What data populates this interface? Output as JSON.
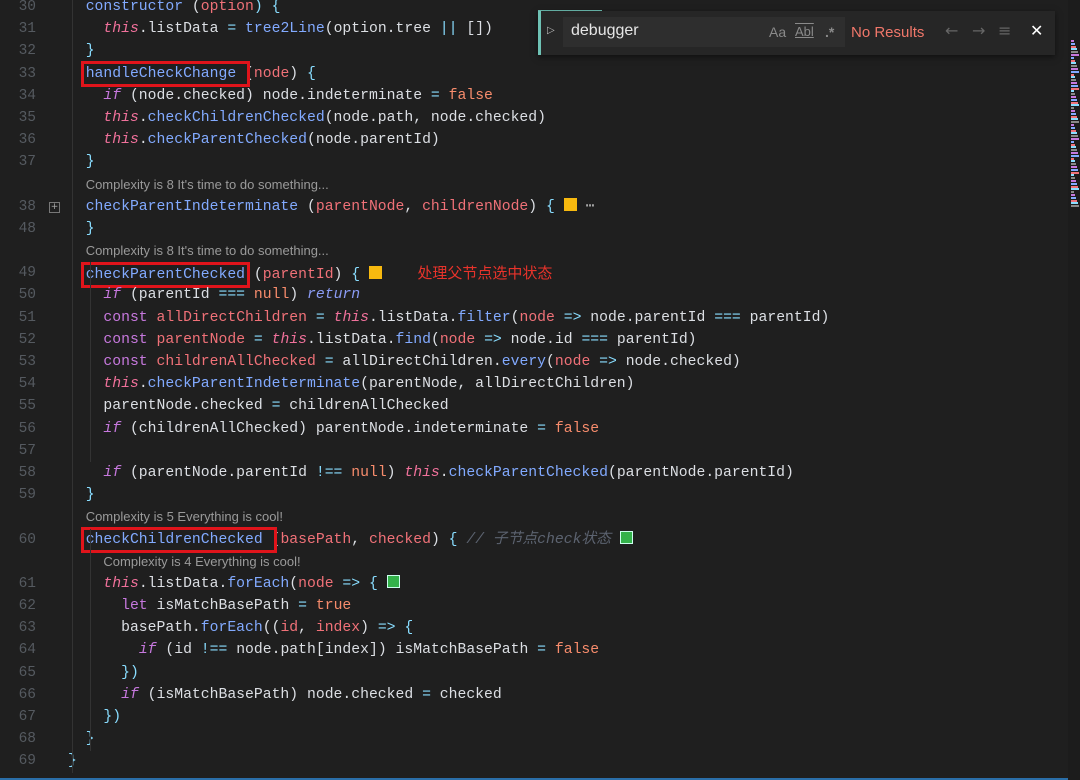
{
  "find": {
    "value": "debugger",
    "match_case": "Aa",
    "whole_word": "Abl",
    "regex": ".*",
    "result": "No Results",
    "prev": "←",
    "next": "→",
    "selection": "≡",
    "close": "✕",
    "toggle": "▷"
  },
  "colors": {
    "accent": "#6fc2b5",
    "highlight_box": "#e0141b",
    "background": "#1f1f1f"
  },
  "rows": [
    {
      "n": "30",
      "t": [
        [
          "  ",
          ""
        ],
        [
          "constructor",
          "fn"
        ],
        [
          " (",
          ""
        ],
        [
          "option",
          "par"
        ],
        [
          ") {",
          "pun"
        ]
      ]
    },
    {
      "n": "31",
      "t": [
        [
          "    ",
          ""
        ],
        [
          "this",
          "this"
        ],
        [
          ".listData ",
          ""
        ],
        [
          "=",
          "op"
        ],
        [
          " ",
          ""
        ],
        [
          "tree2Line",
          "fn"
        ],
        [
          "(option.tree ",
          ""
        ],
        [
          "||",
          "op"
        ],
        [
          " [])",
          ""
        ]
      ]
    },
    {
      "n": "32",
      "t": [
        [
          "  ",
          ""
        ],
        [
          "}",
          "pun"
        ]
      ]
    },
    {
      "n": "33",
      "t": [
        [
          "  ",
          ""
        ],
        [
          "handleCheckChange ",
          "fn boxed"
        ],
        [
          "(",
          ""
        ],
        [
          "node",
          "par"
        ],
        [
          ") ",
          ""
        ],
        [
          "{",
          "pun"
        ]
      ]
    },
    {
      "n": "34",
      "t": [
        [
          "    ",
          ""
        ],
        [
          "if",
          "kwi"
        ],
        [
          " (node.checked) node.indeterminate ",
          ""
        ],
        [
          "=",
          "op"
        ],
        [
          " ",
          ""
        ],
        [
          "false",
          "bool"
        ]
      ]
    },
    {
      "n": "35",
      "t": [
        [
          "    ",
          ""
        ],
        [
          "this",
          "this"
        ],
        [
          ".",
          ""
        ],
        [
          "checkChildrenChecked",
          "fn"
        ],
        [
          "(node.path, node.checked)",
          ""
        ]
      ]
    },
    {
      "n": "36",
      "t": [
        [
          "    ",
          ""
        ],
        [
          "this",
          "this"
        ],
        [
          ".",
          ""
        ],
        [
          "checkParentChecked",
          "fn"
        ],
        [
          "(node.parentId)",
          ""
        ]
      ]
    },
    {
      "n": "37",
      "t": [
        [
          "  ",
          ""
        ],
        [
          "}",
          "pun"
        ]
      ]
    },
    {
      "lens": "Complexity is 8 It's time to do something...",
      "ind": 2
    },
    {
      "n": "38",
      "fold": "+",
      "t": [
        [
          "  ",
          ""
        ],
        [
          "checkParentIndeterminate",
          "fn"
        ],
        [
          " (",
          ""
        ],
        [
          "parentNode",
          "par"
        ],
        [
          ", ",
          ""
        ],
        [
          "childrenNode",
          "par"
        ],
        [
          ") ",
          ""
        ],
        [
          "{",
          "pun"
        ],
        [
          " ",
          ""
        ],
        [
          "",
          "sq-y"
        ],
        [
          " ",
          ""
        ],
        [
          "⋯",
          "ell"
        ]
      ]
    },
    {
      "n": "48",
      "t": [
        [
          "  ",
          ""
        ],
        [
          "}",
          "pun"
        ]
      ]
    },
    {
      "lens": "Complexity is 8 It's time to do something...",
      "ind": 2
    },
    {
      "n": "49",
      "t": [
        [
          "  ",
          ""
        ],
        [
          "checkParentChecked",
          "fn boxed"
        ],
        [
          " (",
          ""
        ],
        [
          "parentId",
          "par"
        ],
        [
          ") ",
          ""
        ],
        [
          "{",
          "pun"
        ],
        [
          " ",
          ""
        ],
        [
          "",
          "sq-y"
        ],
        [
          "    ",
          ""
        ],
        [
          "处理父节点选中状态",
          "note"
        ]
      ]
    },
    {
      "n": "50",
      "t": [
        [
          "    ",
          ""
        ],
        [
          "if",
          "kwi"
        ],
        [
          " (parentId ",
          ""
        ],
        [
          "===",
          "op"
        ],
        [
          " ",
          ""
        ],
        [
          "null",
          "bool"
        ],
        [
          ") ",
          ""
        ],
        [
          "return",
          "ret"
        ]
      ]
    },
    {
      "n": "51",
      "t": [
        [
          "    ",
          ""
        ],
        [
          "const",
          "kw"
        ],
        [
          " ",
          ""
        ],
        [
          "allDirectChildren",
          "par"
        ],
        [
          " ",
          ""
        ],
        [
          "=",
          "op"
        ],
        [
          " ",
          ""
        ],
        [
          "this",
          "this"
        ],
        [
          ".listData.",
          ""
        ],
        [
          "filter",
          "fn"
        ],
        [
          "(",
          ""
        ],
        [
          "node",
          "par"
        ],
        [
          " ",
          ""
        ],
        [
          "=>",
          "op"
        ],
        [
          " node.parentId ",
          ""
        ],
        [
          "===",
          "op"
        ],
        [
          " parentId)",
          ""
        ]
      ]
    },
    {
      "n": "52",
      "t": [
        [
          "    ",
          ""
        ],
        [
          "const",
          "kw"
        ],
        [
          " ",
          ""
        ],
        [
          "parentNode",
          "par"
        ],
        [
          " ",
          ""
        ],
        [
          "=",
          "op"
        ],
        [
          " ",
          ""
        ],
        [
          "this",
          "this"
        ],
        [
          ".listData.",
          ""
        ],
        [
          "find",
          "fn"
        ],
        [
          "(",
          ""
        ],
        [
          "node",
          "par"
        ],
        [
          " ",
          ""
        ],
        [
          "=>",
          "op"
        ],
        [
          " node.id ",
          ""
        ],
        [
          "===",
          "op"
        ],
        [
          " parentId)",
          ""
        ]
      ]
    },
    {
      "n": "53",
      "t": [
        [
          "    ",
          ""
        ],
        [
          "const",
          "kw"
        ],
        [
          " ",
          ""
        ],
        [
          "childrenAllChecked",
          "par"
        ],
        [
          " ",
          ""
        ],
        [
          "=",
          "op"
        ],
        [
          " allDirectChildren.",
          ""
        ],
        [
          "every",
          "fn"
        ],
        [
          "(",
          ""
        ],
        [
          "node",
          "par"
        ],
        [
          " ",
          ""
        ],
        [
          "=>",
          "op"
        ],
        [
          " node.checked)",
          ""
        ]
      ]
    },
    {
      "n": "54",
      "t": [
        [
          "    ",
          ""
        ],
        [
          "this",
          "this"
        ],
        [
          ".",
          ""
        ],
        [
          "checkParentIndeterminate",
          "fn"
        ],
        [
          "(parentNode, allDirectChildren)",
          ""
        ]
      ]
    },
    {
      "n": "55",
      "t": [
        [
          "    parentNode.checked ",
          ""
        ],
        [
          "=",
          "op"
        ],
        [
          " childrenAllChecked",
          ""
        ]
      ]
    },
    {
      "n": "56",
      "t": [
        [
          "    ",
          ""
        ],
        [
          "if",
          "kwi"
        ],
        [
          " (childrenAllChecked) parentNode.indeterminate ",
          ""
        ],
        [
          "=",
          "op"
        ],
        [
          " ",
          ""
        ],
        [
          "false",
          "bool"
        ]
      ]
    },
    {
      "n": "57",
      "t": []
    },
    {
      "n": "58",
      "t": [
        [
          "    ",
          ""
        ],
        [
          "if",
          "kwi"
        ],
        [
          " (parentNode.parentId ",
          ""
        ],
        [
          "!==",
          "op"
        ],
        [
          " ",
          ""
        ],
        [
          "null",
          "bool"
        ],
        [
          ") ",
          ""
        ],
        [
          "this",
          "this"
        ],
        [
          ".",
          ""
        ],
        [
          "checkParentChecked",
          "fn"
        ],
        [
          "(parentNode.parentId)",
          ""
        ]
      ]
    },
    {
      "n": "59",
      "t": [
        [
          "  ",
          ""
        ],
        [
          "}",
          "pun"
        ]
      ]
    },
    {
      "lens": "Complexity is 5 Everything is cool!",
      "ind": 2
    },
    {
      "n": "60",
      "t": [
        [
          "  ",
          ""
        ],
        [
          "checkChildrenChecked ",
          "fn boxed"
        ],
        [
          "(",
          ""
        ],
        [
          "basePath",
          "par"
        ],
        [
          ", ",
          ""
        ],
        [
          "checked",
          "par"
        ],
        [
          ") ",
          ""
        ],
        [
          "{",
          "pun"
        ],
        [
          " ",
          ""
        ],
        [
          "// 子节点check状态",
          "cmt"
        ],
        [
          " ",
          ""
        ],
        [
          "",
          "sq-g"
        ]
      ]
    },
    {
      "lens": "Complexity is 4 Everything is cool!",
      "ind": 4
    },
    {
      "n": "61",
      "t": [
        [
          "    ",
          ""
        ],
        [
          "this",
          "this"
        ],
        [
          ".listData.",
          ""
        ],
        [
          "forEach",
          "fn"
        ],
        [
          "(",
          ""
        ],
        [
          "node",
          "par"
        ],
        [
          " ",
          ""
        ],
        [
          "=>",
          "op"
        ],
        [
          " ",
          ""
        ],
        [
          "{",
          "pun"
        ],
        [
          " ",
          ""
        ],
        [
          "",
          "sq-g"
        ]
      ]
    },
    {
      "n": "62",
      "t": [
        [
          "      ",
          ""
        ],
        [
          "let",
          "kw"
        ],
        [
          " isMatchBasePath ",
          ""
        ],
        [
          "=",
          "op"
        ],
        [
          " ",
          ""
        ],
        [
          "true",
          "bool"
        ]
      ]
    },
    {
      "n": "63",
      "t": [
        [
          "      basePath.",
          ""
        ],
        [
          "forEach",
          "fn"
        ],
        [
          "((",
          ""
        ],
        [
          "id",
          "par"
        ],
        [
          ", ",
          ""
        ],
        [
          "index",
          "par"
        ],
        [
          ") ",
          ""
        ],
        [
          "=>",
          "op"
        ],
        [
          " ",
          ""
        ],
        [
          "{",
          "pun"
        ]
      ]
    },
    {
      "n": "64",
      "t": [
        [
          "        ",
          ""
        ],
        [
          "if",
          "kwi"
        ],
        [
          " (id ",
          ""
        ],
        [
          "!==",
          "op"
        ],
        [
          " node.path[index]) isMatchBasePath ",
          ""
        ],
        [
          "=",
          "op"
        ],
        [
          " ",
          ""
        ],
        [
          "false",
          "bool"
        ]
      ]
    },
    {
      "n": "65",
      "t": [
        [
          "      ",
          ""
        ],
        [
          "})",
          "pun"
        ]
      ]
    },
    {
      "n": "66",
      "t": [
        [
          "      ",
          ""
        ],
        [
          "if",
          "kwi"
        ],
        [
          " (isMatchBasePath) node.checked ",
          ""
        ],
        [
          "=",
          "op"
        ],
        [
          " checked",
          ""
        ]
      ]
    },
    {
      "n": "67",
      "t": [
        [
          "    ",
          ""
        ],
        [
          "})",
          "pun"
        ]
      ]
    },
    {
      "n": "68",
      "t": [
        [
          "  ",
          ""
        ],
        [
          "}",
          "pun"
        ]
      ]
    },
    {
      "n": "69",
      "t": [
        [
          "}",
          "pun"
        ]
      ]
    }
  ]
}
